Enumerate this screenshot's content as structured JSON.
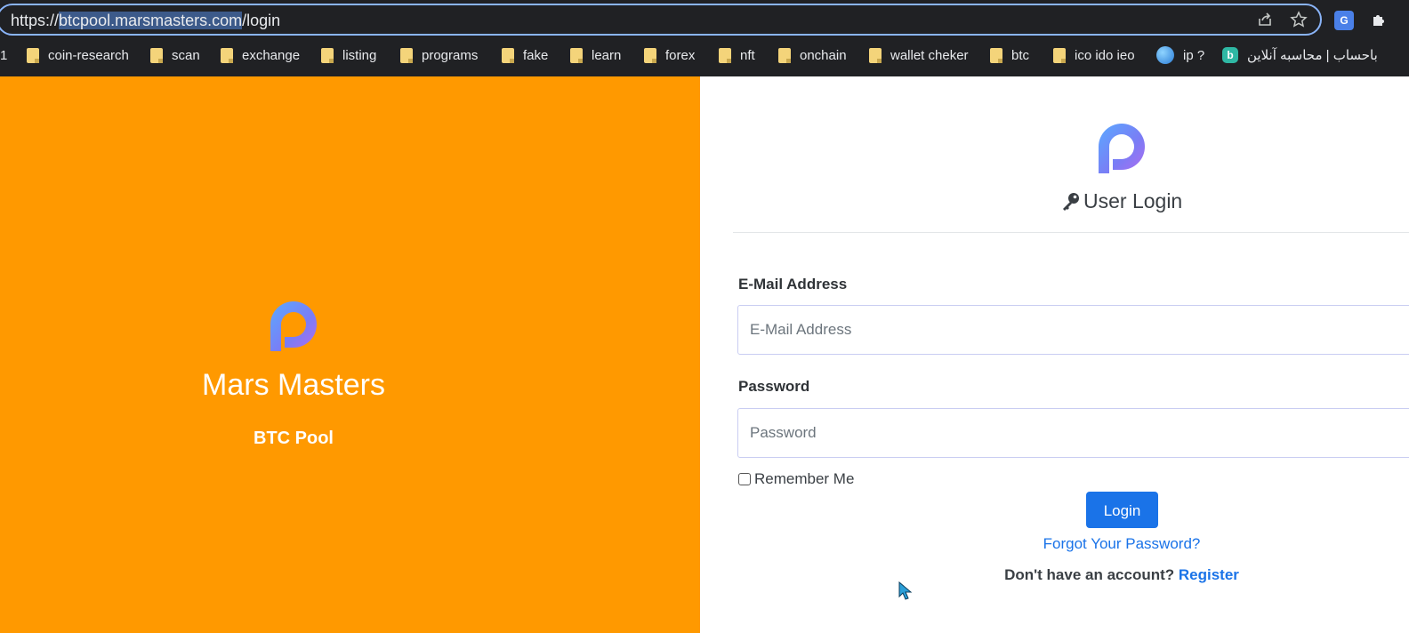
{
  "browser": {
    "url_prefix": "https://",
    "url_host": "btcpool.marsmasters.com",
    "url_path": "/login",
    "bookmarks": [
      {
        "label": "1",
        "icon": "none"
      },
      {
        "label": "coin-research",
        "icon": "folder-icon"
      },
      {
        "label": "scan",
        "icon": "folder-icon"
      },
      {
        "label": "exchange",
        "icon": "folder-icon"
      },
      {
        "label": "listing",
        "icon": "folder-icon"
      },
      {
        "label": "programs",
        "icon": "folder-icon"
      },
      {
        "label": "fake",
        "icon": "folder-icon"
      },
      {
        "label": "learn",
        "icon": "folder-icon"
      },
      {
        "label": "forex",
        "icon": "folder-icon"
      },
      {
        "label": "nft",
        "icon": "folder-icon"
      },
      {
        "label": "onchain",
        "icon": "folder-icon"
      },
      {
        "label": "wallet cheker",
        "icon": "folder-icon"
      },
      {
        "label": "btc",
        "icon": "folder-icon"
      },
      {
        "label": "ico ido ieo",
        "icon": "folder-icon"
      },
      {
        "label": "ip ?",
        "icon": "globe-icon"
      },
      {
        "label": "باحساب | محاسبه آنلاین",
        "icon": "bale-icon"
      }
    ]
  },
  "brand": {
    "name": "Mars Masters",
    "subtitle": "BTC Pool",
    "color": "#ff9900"
  },
  "login": {
    "title": "User Login",
    "email_label": "E-Mail Address",
    "email_placeholder": "E-Mail Address",
    "password_label": "Password",
    "password_placeholder": "Password",
    "remember_label": "Remember Me",
    "button_label": "Login",
    "forgot_label": "Forgot Your Password?",
    "no_account_text": "Don't have an account?",
    "register_label": "Register",
    "accent_color": "#1a73e8"
  }
}
